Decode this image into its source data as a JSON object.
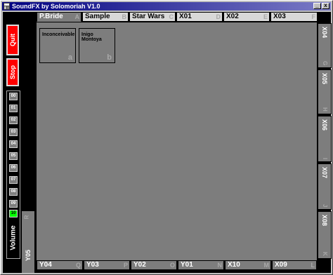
{
  "window": {
    "title": "SoundFX by Solomoriah V1.0",
    "min_glyph": "_",
    "close_glyph": "x"
  },
  "colors": {
    "accent": "#ff0000",
    "panel": "#7d7d7d",
    "selected": "#00ff00",
    "titlebar": "#000080"
  },
  "controls": {
    "quit": "Quit",
    "stop": "Stop"
  },
  "volume": {
    "label": "Volume",
    "levels": [
      "00",
      "01",
      "02",
      "03",
      "04",
      "05",
      "06",
      "07",
      "08",
      "09",
      "10"
    ],
    "selected": "10"
  },
  "side": {
    "label": "Y05",
    "key": "R"
  },
  "top_tabs": [
    {
      "label": "P.Bride",
      "key": "A"
    },
    {
      "label": "Sample",
      "key": "B"
    },
    {
      "label": "Star Wars",
      "key": "C"
    },
    {
      "label": "X01",
      "key": "D"
    },
    {
      "label": "X02",
      "key": "E"
    },
    {
      "label": "X03",
      "key": "F"
    }
  ],
  "right_tabs": [
    {
      "label": "X04",
      "key": "G"
    },
    {
      "label": "X05",
      "key": "H"
    },
    {
      "label": "X06",
      "key": "I"
    },
    {
      "label": "X07",
      "key": "J"
    },
    {
      "label": "X08",
      "key": "K"
    }
  ],
  "bottom_tabs": [
    {
      "label": "Y04",
      "key": "Q"
    },
    {
      "label": "Y03",
      "key": "P"
    },
    {
      "label": "Y02",
      "key": "O"
    },
    {
      "label": "Y01",
      "key": "N"
    },
    {
      "label": "X10",
      "key": "M"
    },
    {
      "label": "X09",
      "key": "L"
    }
  ],
  "pads": [
    {
      "label": "Inconceivable",
      "key": "a"
    },
    {
      "label": "Inigo Montoya",
      "key": "b"
    }
  ]
}
